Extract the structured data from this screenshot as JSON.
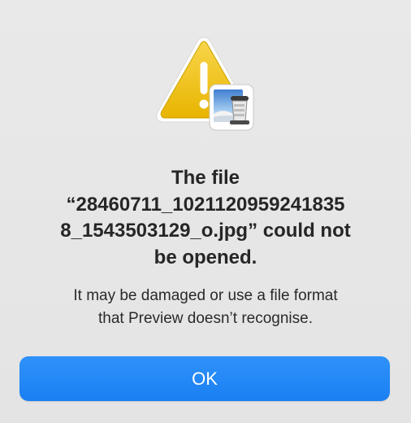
{
  "dialog": {
    "icon": "warning-triangle-icon",
    "badge_icon": "preview-app-icon",
    "title_lines": [
      "The file",
      "“28460711_1021120959241835",
      "8_1543503129_o.jpg” could not",
      "be opened."
    ],
    "message_lines": [
      "It may be damaged or use a file format",
      "that Preview doesn’t recognise."
    ],
    "ok_label": "OK"
  },
  "colors": {
    "background": "#e6e6e6",
    "accent_button": "#1f86f6",
    "warning_yellow": "#f2c200"
  }
}
